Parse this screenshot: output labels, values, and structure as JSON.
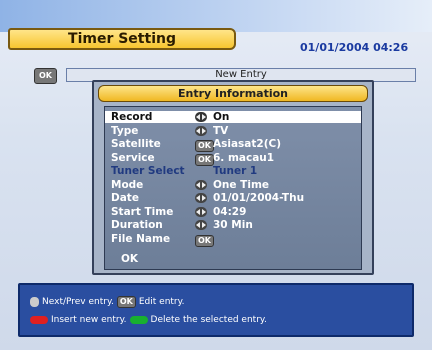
{
  "header": {
    "title": "Timer Setting",
    "datetime": "01/01/2004 04:26"
  },
  "top_bar": {
    "ok_key": "OK",
    "label": "New Entry"
  },
  "dialog": {
    "title": "Entry Information",
    "rows": [
      {
        "label": "Record",
        "value": "On",
        "icon": "left-right-arrow-icon",
        "selected": true
      },
      {
        "label": "Type",
        "value": "TV",
        "icon": "left-right-arrow-icon"
      },
      {
        "label": "Satellite",
        "value": "Asiasat2(C)",
        "icon": "ok-key-icon"
      },
      {
        "label": "Service",
        "value": "6. macau1",
        "icon": "ok-key-icon"
      },
      {
        "label": "Tuner Select",
        "value": "Tuner 1",
        "icon": "",
        "dim": true
      },
      {
        "label": "Mode",
        "value": "One Time",
        "icon": "left-right-arrow-icon"
      },
      {
        "label": "Date",
        "value": "01/01/2004-Thu",
        "icon": "left-right-arrow-icon"
      },
      {
        "label": "Start Time",
        "value": "04:29",
        "icon": "left-right-arrow-icon"
      },
      {
        "label": "Duration",
        "value": "30 Min",
        "icon": "left-right-arrow-icon"
      },
      {
        "label": "File Name",
        "value": "",
        "icon": "ok-key-icon"
      }
    ],
    "ok_label": "OK"
  },
  "help": {
    "line1_a": "Next/Prev entry.",
    "line1_key": "OK",
    "line1_b": "Edit entry.",
    "line2_a": "Insert new entry.",
    "line2_b": "Delete the selected entry."
  },
  "colors": {
    "accent": "#f7c530",
    "help_bg": "#2a4ea0",
    "red": "#e02020",
    "green": "#18b030"
  }
}
